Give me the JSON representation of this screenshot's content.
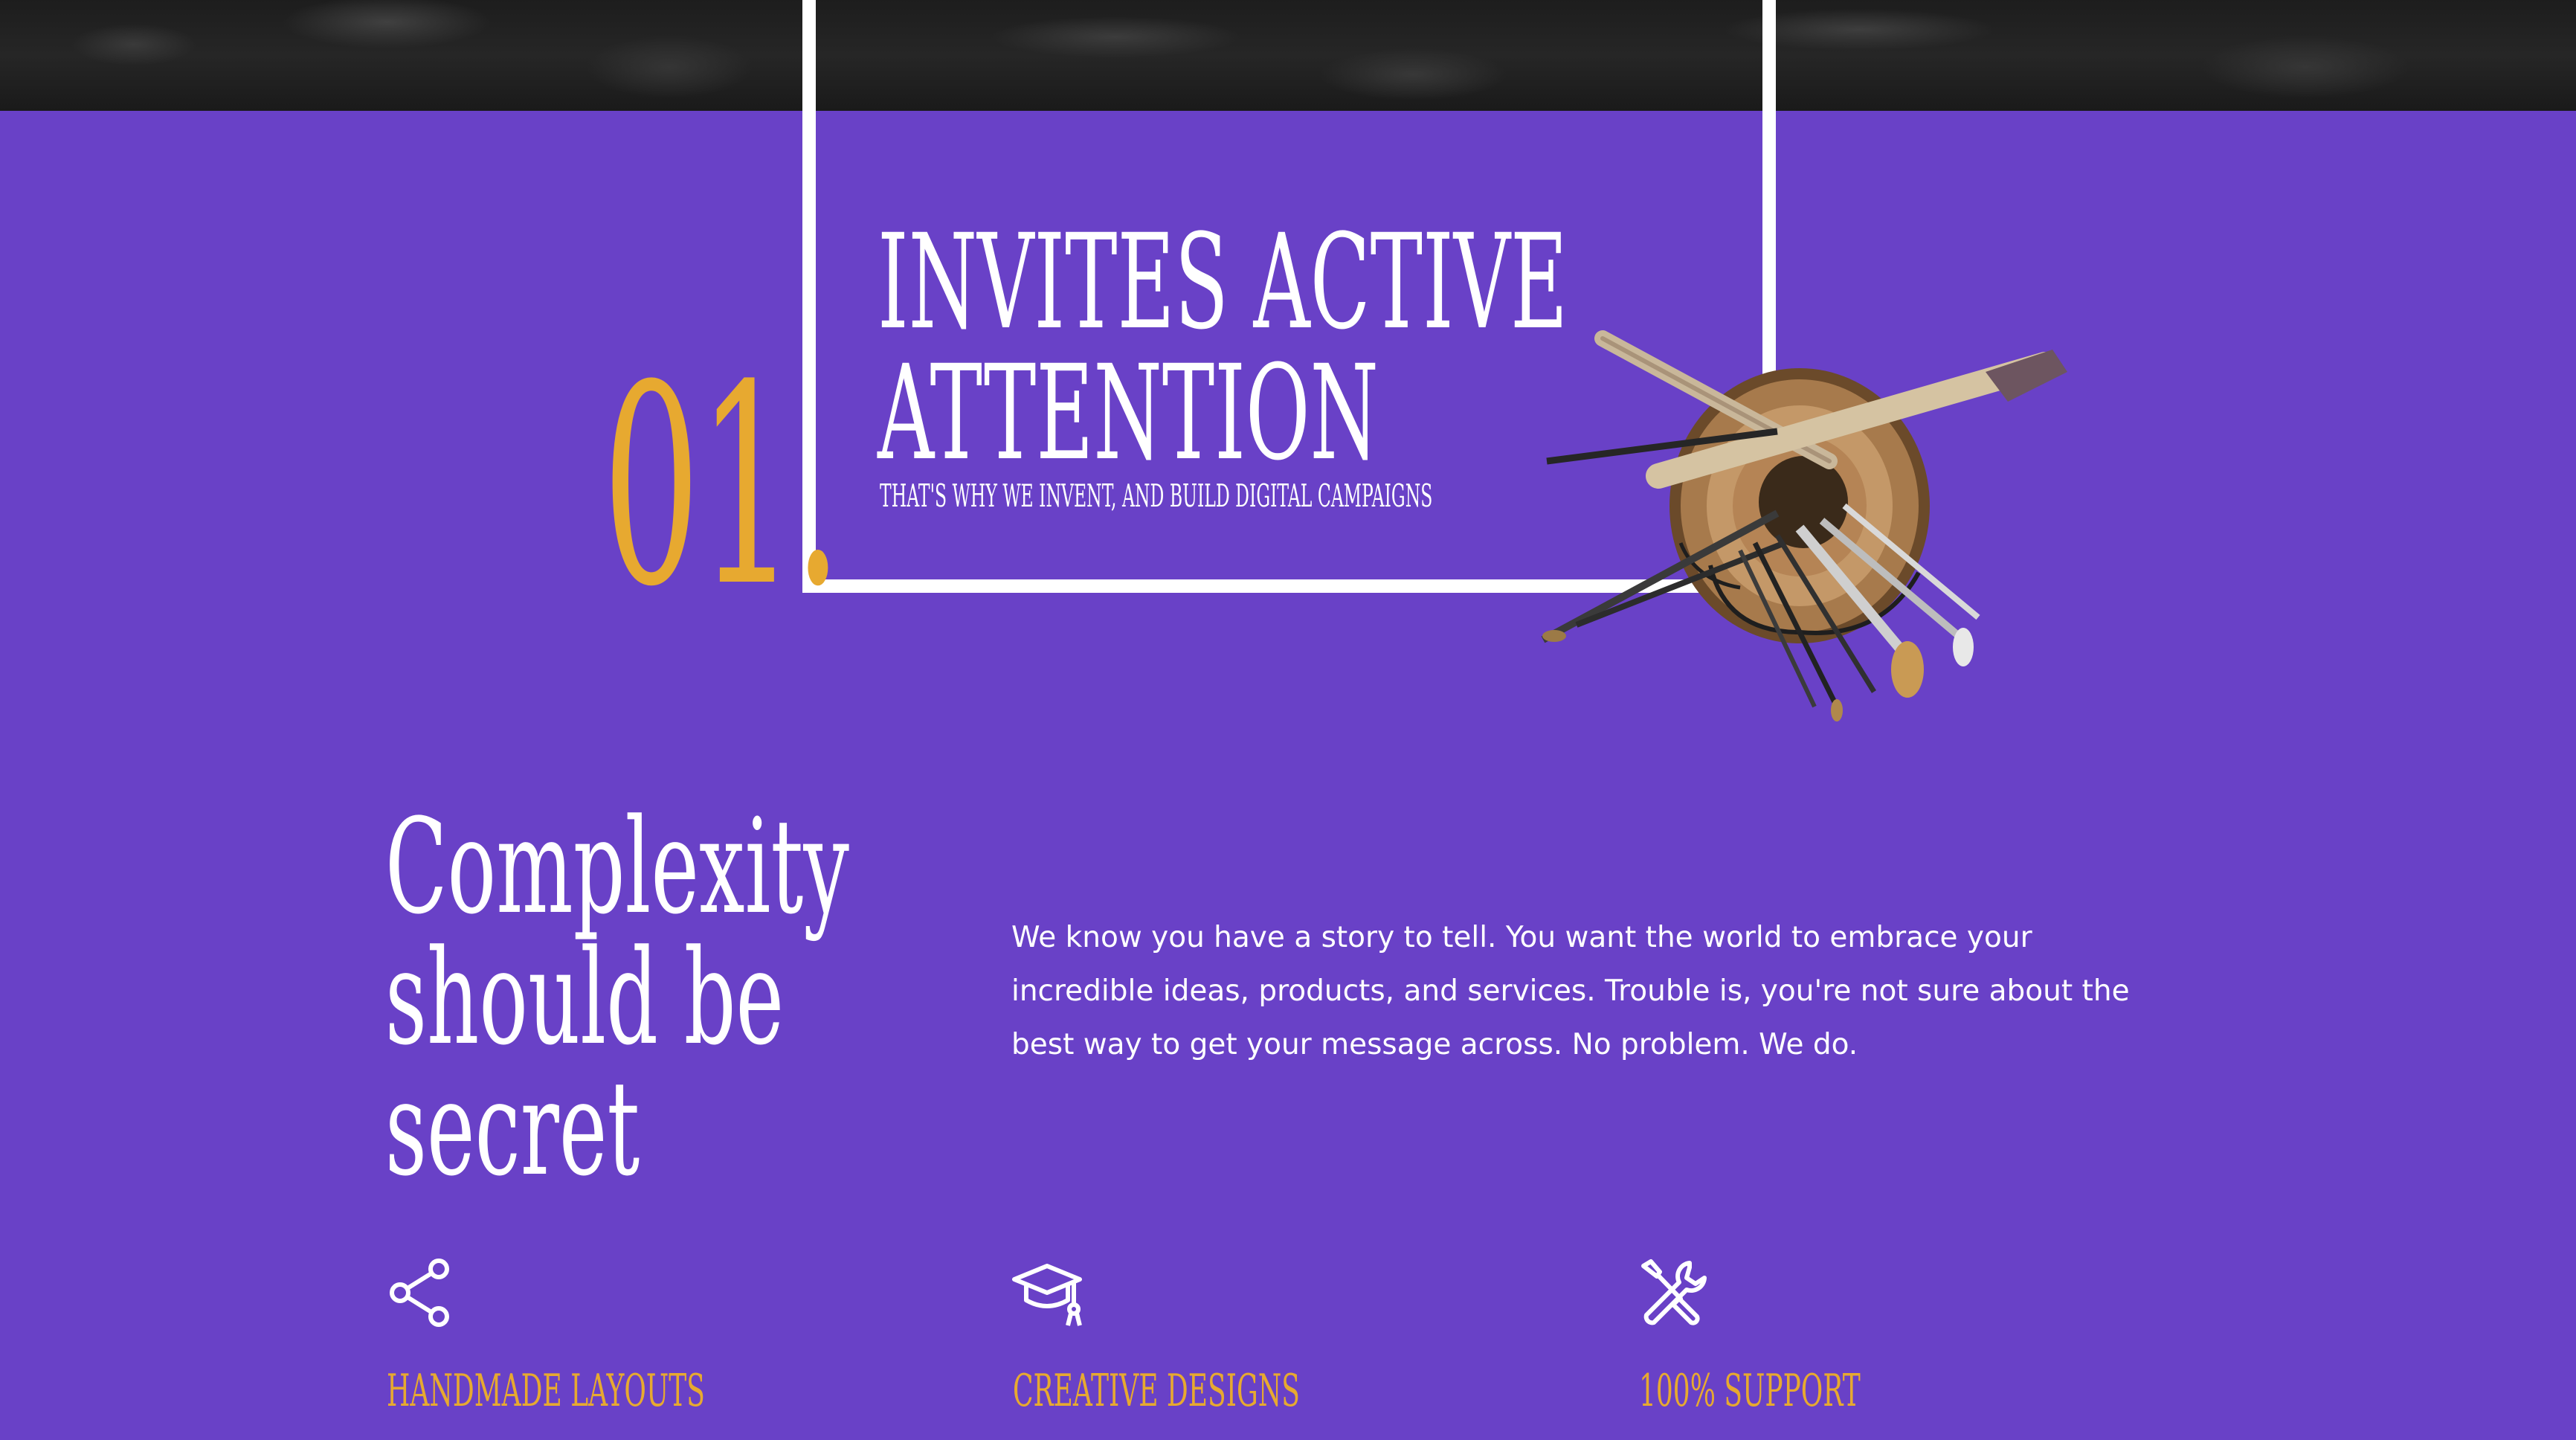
{
  "hero": {
    "number": "01.",
    "headline_line1": "INVITES ACTIVE",
    "headline_line2": "ATTENTION",
    "tagline": "THAT'S WHY WE INVENT, AND BUILD DIGITAL CAMPAIGNS"
  },
  "intro": {
    "heading_line1": "Complexity",
    "heading_line2": "should be",
    "heading_line3": "secret",
    "body": "We know you have a story to tell. You want the world to embrace your incredible ideas, products, and services. Trouble is, you're not sure about the best way to get your message across. No problem. We do."
  },
  "features": [
    {
      "icon": "share-icon",
      "label": "HANDMADE LAYOUTS"
    },
    {
      "icon": "graduation-cap-icon",
      "label": "CREATIVE DESIGNS"
    },
    {
      "icon": "tools-icon",
      "label": "100% SUPPORT"
    }
  ],
  "colors": {
    "background": "#6941c7",
    "accent": "#e7a930",
    "text": "#ffffff",
    "top_strip": "#1d1d1d"
  }
}
